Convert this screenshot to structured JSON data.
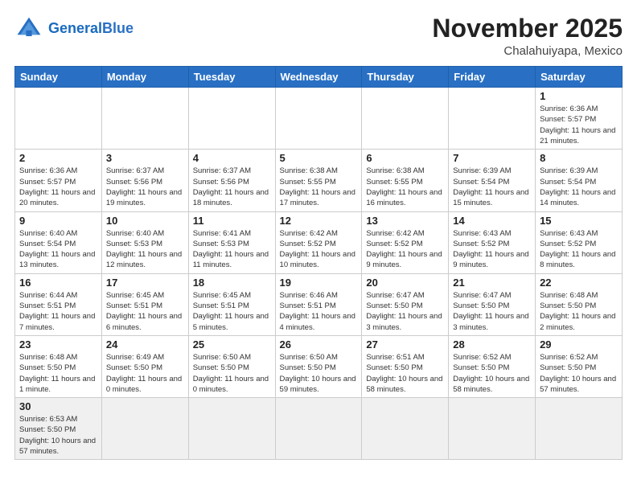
{
  "header": {
    "logo_general": "General",
    "logo_blue": "Blue",
    "month_title": "November 2025",
    "location": "Chalahuiyapa, Mexico"
  },
  "days_of_week": [
    "Sunday",
    "Monday",
    "Tuesday",
    "Wednesday",
    "Thursday",
    "Friday",
    "Saturday"
  ],
  "weeks": [
    [
      {
        "day": "",
        "info": ""
      },
      {
        "day": "",
        "info": ""
      },
      {
        "day": "",
        "info": ""
      },
      {
        "day": "",
        "info": ""
      },
      {
        "day": "",
        "info": ""
      },
      {
        "day": "",
        "info": ""
      },
      {
        "day": "1",
        "info": "Sunrise: 6:36 AM\nSunset: 5:57 PM\nDaylight: 11 hours and 21 minutes."
      }
    ],
    [
      {
        "day": "2",
        "info": "Sunrise: 6:36 AM\nSunset: 5:57 PM\nDaylight: 11 hours and 20 minutes."
      },
      {
        "day": "3",
        "info": "Sunrise: 6:37 AM\nSunset: 5:56 PM\nDaylight: 11 hours and 19 minutes."
      },
      {
        "day": "4",
        "info": "Sunrise: 6:37 AM\nSunset: 5:56 PM\nDaylight: 11 hours and 18 minutes."
      },
      {
        "day": "5",
        "info": "Sunrise: 6:38 AM\nSunset: 5:55 PM\nDaylight: 11 hours and 17 minutes."
      },
      {
        "day": "6",
        "info": "Sunrise: 6:38 AM\nSunset: 5:55 PM\nDaylight: 11 hours and 16 minutes."
      },
      {
        "day": "7",
        "info": "Sunrise: 6:39 AM\nSunset: 5:54 PM\nDaylight: 11 hours and 15 minutes."
      },
      {
        "day": "8",
        "info": "Sunrise: 6:39 AM\nSunset: 5:54 PM\nDaylight: 11 hours and 14 minutes."
      }
    ],
    [
      {
        "day": "9",
        "info": "Sunrise: 6:40 AM\nSunset: 5:54 PM\nDaylight: 11 hours and 13 minutes."
      },
      {
        "day": "10",
        "info": "Sunrise: 6:40 AM\nSunset: 5:53 PM\nDaylight: 11 hours and 12 minutes."
      },
      {
        "day": "11",
        "info": "Sunrise: 6:41 AM\nSunset: 5:53 PM\nDaylight: 11 hours and 11 minutes."
      },
      {
        "day": "12",
        "info": "Sunrise: 6:42 AM\nSunset: 5:52 PM\nDaylight: 11 hours and 10 minutes."
      },
      {
        "day": "13",
        "info": "Sunrise: 6:42 AM\nSunset: 5:52 PM\nDaylight: 11 hours and 9 minutes."
      },
      {
        "day": "14",
        "info": "Sunrise: 6:43 AM\nSunset: 5:52 PM\nDaylight: 11 hours and 9 minutes."
      },
      {
        "day": "15",
        "info": "Sunrise: 6:43 AM\nSunset: 5:52 PM\nDaylight: 11 hours and 8 minutes."
      }
    ],
    [
      {
        "day": "16",
        "info": "Sunrise: 6:44 AM\nSunset: 5:51 PM\nDaylight: 11 hours and 7 minutes."
      },
      {
        "day": "17",
        "info": "Sunrise: 6:45 AM\nSunset: 5:51 PM\nDaylight: 11 hours and 6 minutes."
      },
      {
        "day": "18",
        "info": "Sunrise: 6:45 AM\nSunset: 5:51 PM\nDaylight: 11 hours and 5 minutes."
      },
      {
        "day": "19",
        "info": "Sunrise: 6:46 AM\nSunset: 5:51 PM\nDaylight: 11 hours and 4 minutes."
      },
      {
        "day": "20",
        "info": "Sunrise: 6:47 AM\nSunset: 5:50 PM\nDaylight: 11 hours and 3 minutes."
      },
      {
        "day": "21",
        "info": "Sunrise: 6:47 AM\nSunset: 5:50 PM\nDaylight: 11 hours and 3 minutes."
      },
      {
        "day": "22",
        "info": "Sunrise: 6:48 AM\nSunset: 5:50 PM\nDaylight: 11 hours and 2 minutes."
      }
    ],
    [
      {
        "day": "23",
        "info": "Sunrise: 6:48 AM\nSunset: 5:50 PM\nDaylight: 11 hours and 1 minute."
      },
      {
        "day": "24",
        "info": "Sunrise: 6:49 AM\nSunset: 5:50 PM\nDaylight: 11 hours and 0 minutes."
      },
      {
        "day": "25",
        "info": "Sunrise: 6:50 AM\nSunset: 5:50 PM\nDaylight: 11 hours and 0 minutes."
      },
      {
        "day": "26",
        "info": "Sunrise: 6:50 AM\nSunset: 5:50 PM\nDaylight: 10 hours and 59 minutes."
      },
      {
        "day": "27",
        "info": "Sunrise: 6:51 AM\nSunset: 5:50 PM\nDaylight: 10 hours and 58 minutes."
      },
      {
        "day": "28",
        "info": "Sunrise: 6:52 AM\nSunset: 5:50 PM\nDaylight: 10 hours and 58 minutes."
      },
      {
        "day": "29",
        "info": "Sunrise: 6:52 AM\nSunset: 5:50 PM\nDaylight: 10 hours and 57 minutes."
      }
    ],
    [
      {
        "day": "30",
        "info": "Sunrise: 6:53 AM\nSunset: 5:50 PM\nDaylight: 10 hours and 57 minutes."
      },
      {
        "day": "",
        "info": ""
      },
      {
        "day": "",
        "info": ""
      },
      {
        "day": "",
        "info": ""
      },
      {
        "day": "",
        "info": ""
      },
      {
        "day": "",
        "info": ""
      },
      {
        "day": "",
        "info": ""
      }
    ]
  ]
}
